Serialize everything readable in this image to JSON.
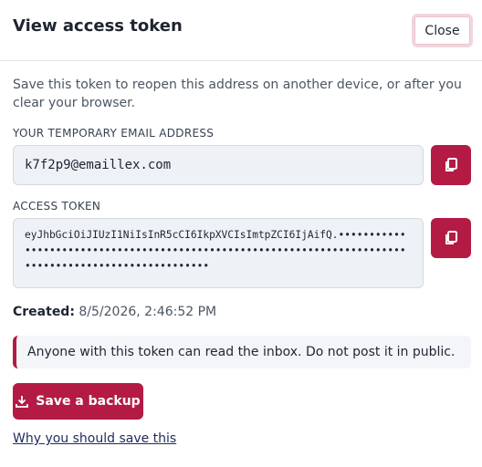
{
  "dialog": {
    "title": "View access token",
    "close_label": "Close",
    "intro": "Save this token to reopen this address on another device, or after you clear your browser."
  },
  "email": {
    "label": "YOUR TEMPORARY EMAIL ADDRESS",
    "value": "k7f2p9@emaillex.com",
    "copy_icon": "copy-icon"
  },
  "token": {
    "label": "ACCESS TOKEN",
    "value": "eyJhbGciOiJIUzI1NiIsInR5cCI6IkpXVCIsImtpZCI6IjAifQ.•••••••••••••••••••••••••••••••••••••••••••••••••••••••••••••••••••••••••••••••••••••••••••••••••••••••",
    "copy_icon": "copy-icon"
  },
  "created": {
    "label": "Created:",
    "value": "8/5/2026, 2:46:52 PM"
  },
  "warning": {
    "text": "Anyone with this token can read the inbox. Do not post it in public."
  },
  "actions": {
    "save_label": "Save a backup",
    "save_icon": "download-icon",
    "why_link": "Why you should save this"
  },
  "colors": {
    "accent": "#b31b45",
    "field_bg": "#eef1f6",
    "text": "#1f2533"
  }
}
